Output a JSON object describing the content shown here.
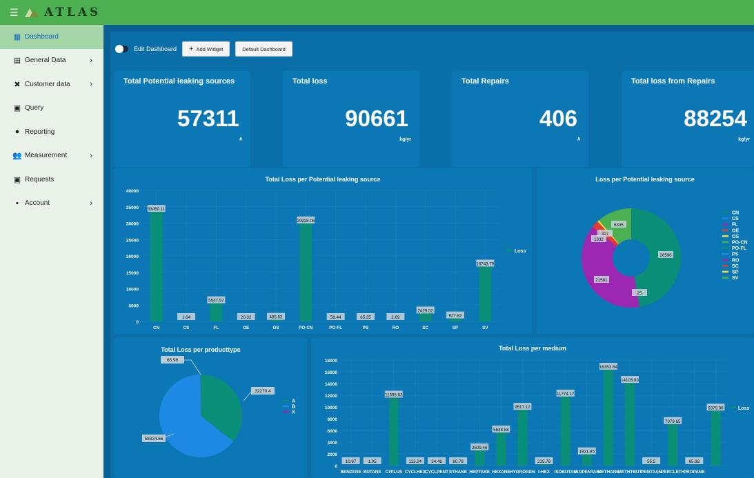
{
  "header": {
    "brand": "ATLAS"
  },
  "sidebar": {
    "items": [
      {
        "label": "Dashboard",
        "icon": "dashboard-icon",
        "chevron": false,
        "active": true
      },
      {
        "label": "General Data",
        "icon": "list-icon",
        "chevron": true,
        "active": false
      },
      {
        "label": "Customer data",
        "icon": "tools-icon",
        "chevron": true,
        "active": false
      },
      {
        "label": "Query",
        "icon": "query-icon",
        "chevron": false,
        "active": false
      },
      {
        "label": "Reporting",
        "icon": "bubbles-icon",
        "chevron": false,
        "active": false
      },
      {
        "label": "Measurement",
        "icon": "people-icon",
        "chevron": true,
        "active": false
      },
      {
        "label": "Requests",
        "icon": "requests-icon",
        "chevron": false,
        "active": false
      },
      {
        "label": "Account",
        "icon": "account-icon",
        "chevron": true,
        "active": false
      }
    ]
  },
  "toolbar": {
    "edit_label": "Edit Dashboard",
    "add_widget_label": "Add Widget",
    "default_label": "Default Dashboard"
  },
  "kpis": [
    {
      "title": "Total Potential leaking sources",
      "value": "57311",
      "unit": "#"
    },
    {
      "title": "Total loss",
      "value": "90661",
      "unit": "kg/yr"
    },
    {
      "title": "Total Repairs",
      "value": "406",
      "unit": "#"
    },
    {
      "title": "Total loss from Repairs",
      "value": "88254",
      "unit": "kg/yr"
    }
  ],
  "colors": {
    "green": "#0b8e77",
    "purple": "#9c27b0",
    "blue": "#1e88e5",
    "lightgreen": "#4caf50"
  },
  "chart_data": [
    {
      "type": "bar",
      "title": "Total Loss per Potential leaking source",
      "categories": [
        "CN",
        "CS",
        "FL",
        "OE",
        "OS",
        "PO-CN",
        "PO-FL",
        "PS",
        "RO",
        "SC",
        "SP",
        "SV"
      ],
      "series": [
        {
          "name": "Loss",
          "values": [
            33450.11,
            1.64,
            5547.57,
            20.32,
            485.53,
            29928.06,
            58.44,
            65.35,
            2.69,
            2429.52,
            927.82,
            16743.79
          ]
        }
      ],
      "labels": [
        "33450.11",
        "1.64",
        "5547.57",
        "20.32",
        "485.53",
        "29928.06",
        "58.44",
        "65.35",
        "2.69",
        "2429.52",
        "927.82",
        "16743.79"
      ],
      "yticks": [
        "40000",
        "35000",
        "30000",
        "25000",
        "20000",
        "15000",
        "10000",
        "5000",
        "0"
      ],
      "ylim": [
        0,
        40000
      ]
    },
    {
      "type": "pie",
      "title": "Loss per Potential leaking source",
      "legend": [
        "CN",
        "CS",
        "FL",
        "OE",
        "OS",
        "PO-CN",
        "PO-FL",
        "PS",
        "RO",
        "SC",
        "SP",
        "SV"
      ],
      "legend_colors": [
        "#0b8e77",
        "#1e88e5",
        "#9c27b0",
        "#e53935",
        "#fdd835",
        "#4caf50",
        "#0b8e77",
        "#1e88e5",
        "#9c27b0",
        "#e53935",
        "#fdd835",
        "#4caf50"
      ],
      "slices": [
        {
          "label": "CN",
          "value": 26596
        },
        {
          "label": "RO",
          "value": 21581
        },
        {
          "label": "SC",
          "value": 1332
        },
        {
          "label": "SP",
          "value": 317
        },
        {
          "label": "SV",
          "value": 6335
        }
      ],
      "slice_labels": [
        "26596",
        "21581",
        "25",
        "1332",
        "317",
        "6335"
      ]
    },
    {
      "type": "pie",
      "title": "Total Loss per producttype",
      "legend": [
        "A",
        "B",
        "X"
      ],
      "slices": [
        {
          "label": "A",
          "value": 32270.4
        },
        {
          "label": "B",
          "value": 58324.66
        },
        {
          "label": "X",
          "value": 65.98
        }
      ]
    },
    {
      "type": "bar",
      "title": "Total Loss per medium",
      "categories": [
        "BENZENE",
        "BUTANE",
        "C7PLUS",
        "CYCLHEX",
        "CYCLPENT",
        "ETHANE",
        "HEPTANE",
        "HEXANE",
        "HYDROGEN",
        "I-HEX",
        "ISOBUTAN",
        "ISOPENTAN",
        "METHANE",
        "METHTBUT",
        "PENTAAN",
        "PERCLETH",
        "PROPANE"
      ],
      "series": [
        {
          "name": "Loss",
          "values": [
            10.87,
            1.05,
            11595.63,
            113.24,
            34.46,
            80.78,
            2609.46,
            5648.58,
            9517.12,
            215.76,
            11774.17,
            1921.85,
            16353.84,
            14103.83,
            55.5,
            7079.65,
            65.98,
            9379.06
          ]
        }
      ],
      "labels": [
        "10.87",
        "1.05",
        "11595.63",
        "113.24",
        "34.46",
        "80.78",
        "2609.46",
        "5648.58",
        "9517.12",
        "215.76",
        "11774.17",
        "1921.85",
        "16353.84",
        "14103.83",
        "55.5",
        "7079.65",
        "65.98",
        "9379.06"
      ],
      "yticks": [
        "18000",
        "16000",
        "14000",
        "12000",
        "10000",
        "8000",
        "6000",
        "4000",
        "2000",
        "0"
      ],
      "ylim": [
        0,
        18000
      ]
    }
  ]
}
